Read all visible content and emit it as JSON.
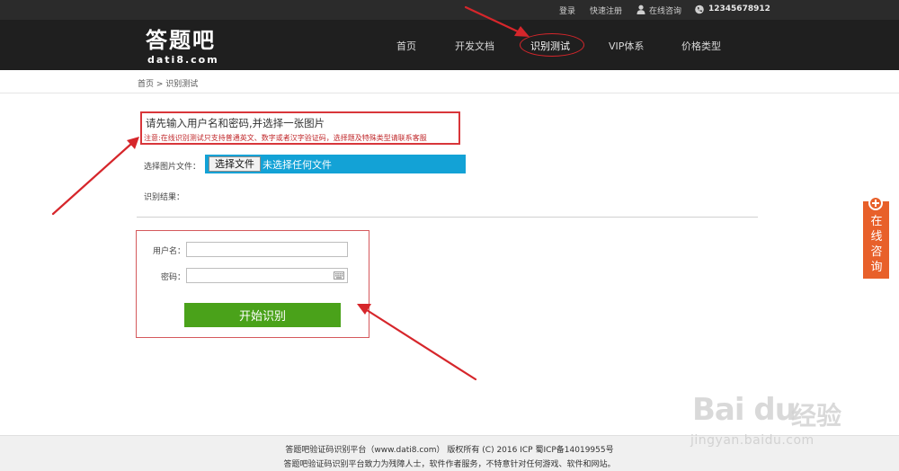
{
  "topbar": {
    "login": "登录",
    "register": "快速注册",
    "online": "在线咨询",
    "phone": "12345678912"
  },
  "header": {
    "logo_main": "答题吧",
    "logo_sub": "dati8.com",
    "nav": [
      "首页",
      "开发文档",
      "识别测试",
      "VIP体系",
      "价格类型"
    ],
    "active_nav": "识别测试"
  },
  "breadcrumb": "首页 > 识别测试",
  "notice": {
    "title": "请先输入用户名和密码,并选择一张图片",
    "warning": "注意:在线识别测试只支持普通英文、数字或者汉字验证码，选择题及特殊类型请联系客服"
  },
  "file": {
    "label": "选择图片文件：",
    "button": "选择文件",
    "status": "未选择任何文件"
  },
  "result": {
    "label": "识别结果："
  },
  "form": {
    "username_label": "用户名：",
    "password_label": "密码：",
    "username_value": "",
    "password_value": "",
    "submit": "开始识别"
  },
  "side_tab": {
    "text": "在线咨询"
  },
  "footer": {
    "line1": "答题吧验证码识别平台（www.dati8.com） 版权所有 (C) 2016 ICP 蜀ICP备14019955号",
    "line2": "答题吧验证码识别平台致力为残障人士，软件作者服务，不特意针对任何游戏、软件和网站。"
  },
  "watermark": {
    "main": "Bai du",
    "cn": "经验",
    "url": "jingyan.baidu.com"
  },
  "colors": {
    "header_bg": "#1f1f1f",
    "annotation_red": "#d6262b",
    "file_bar": "#13a2d6",
    "start_button": "#4aa21a",
    "side_tab": "#e8602a"
  }
}
